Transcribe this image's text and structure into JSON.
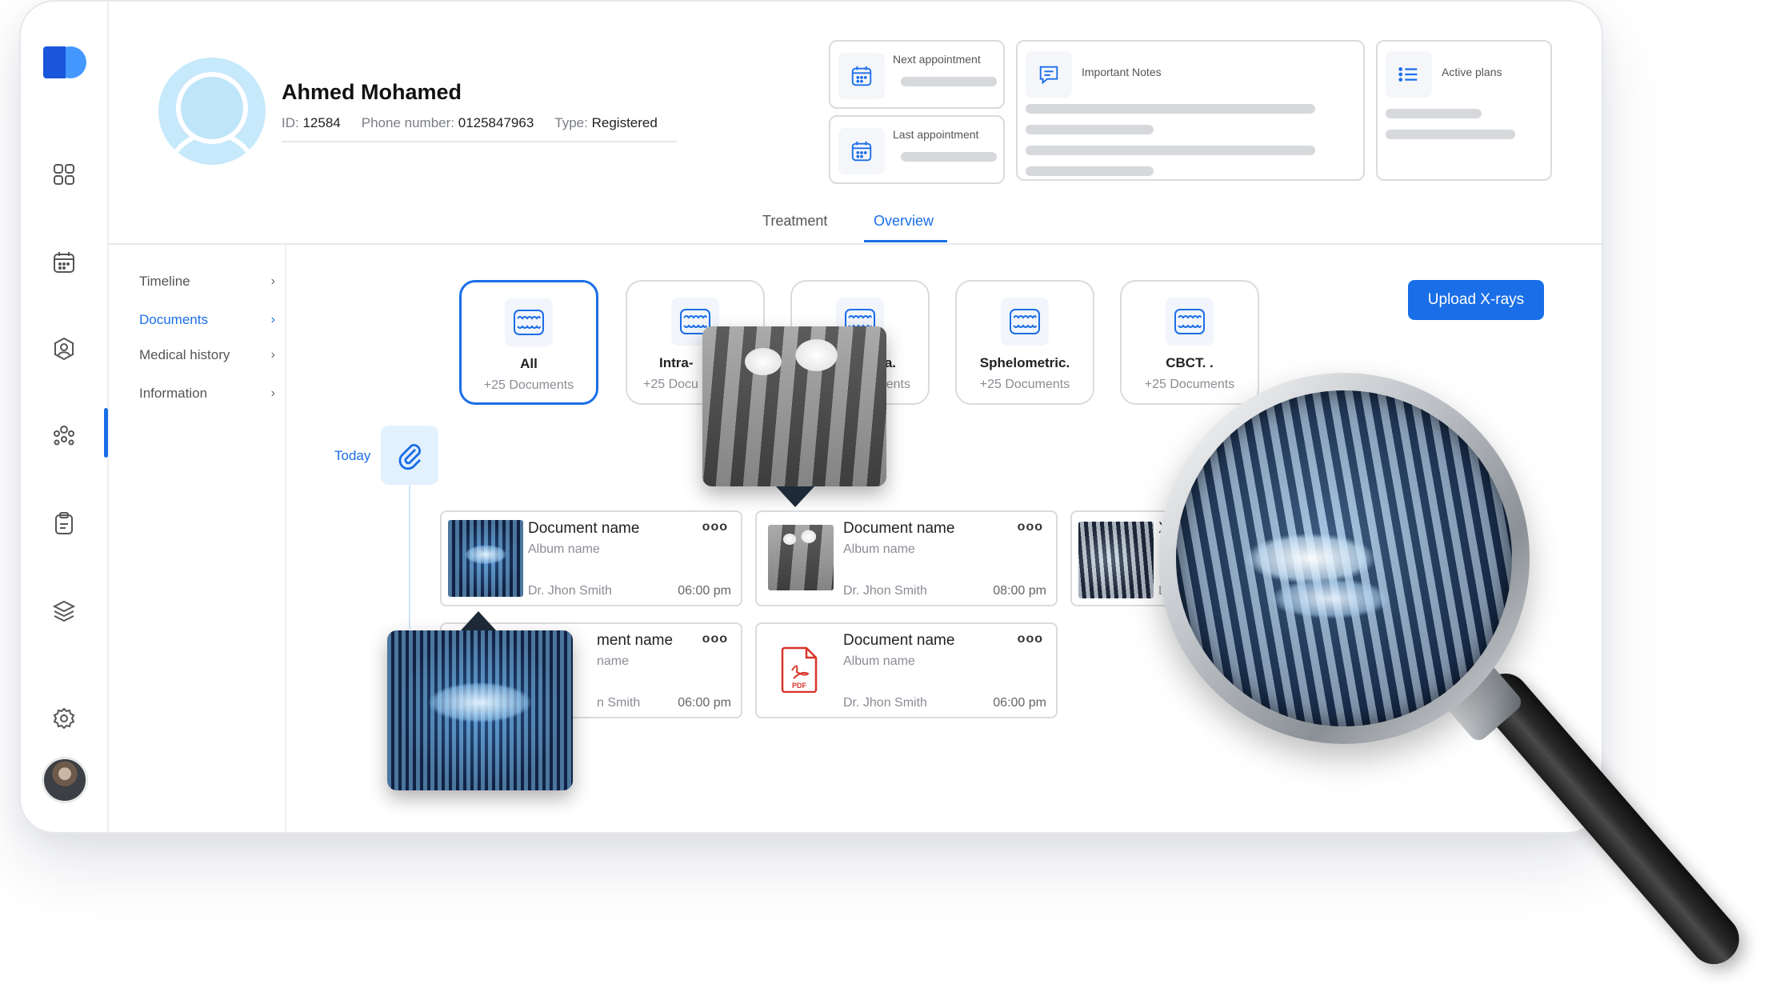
{
  "patient": {
    "name": "Ahmed Mohamed",
    "id_label": "ID:",
    "id_value": "12584",
    "phone_label": "Phone number:",
    "phone_value": "0125847963",
    "type_label": "Type:",
    "type_value": "Registered"
  },
  "cards": {
    "next_appointment": "Next appointment",
    "last_appointment": "Last appointment",
    "important_notes": "Important Notes",
    "active_plans": "Active plans"
  },
  "tabs": [
    {
      "label": "Treatment",
      "active": false
    },
    {
      "label": "Overview",
      "active": true
    }
  ],
  "menu": [
    {
      "label": "Timeline",
      "active": false
    },
    {
      "label": "Documents",
      "active": true
    },
    {
      "label": "Medical history",
      "active": false
    },
    {
      "label": "Information",
      "active": false
    }
  ],
  "categories": [
    {
      "name": "All",
      "count": "+25 Documents",
      "active": true
    },
    {
      "name": "Intra-",
      "count": "+25 Docu",
      "active": false
    },
    {
      "name": "a.",
      "count": "ents",
      "active": false
    },
    {
      "name": "Sphelometric.",
      "count": "+25 Documents",
      "active": false
    },
    {
      "name": "CBCT. .",
      "count": "+25 Documents",
      "active": false
    }
  ],
  "upload_button": "Upload X-rays",
  "timeline": {
    "today": "Today"
  },
  "documents": [
    {
      "name": "Document name",
      "album": "Album name",
      "doctor": "Dr. Jhon Smith",
      "time": "06:00 pm"
    },
    {
      "name": "Document name",
      "album": "Album name",
      "doctor": "Dr. Jhon Smith",
      "time": "08:00 pm"
    },
    {
      "name": "X",
      "album": "",
      "doctor": "D",
      "time": ""
    },
    {
      "name": "ment name",
      "album": "name",
      "doctor": "n Smith",
      "time": "06:00 pm"
    },
    {
      "name": "Document name",
      "album": "Album name",
      "doctor": "Dr. Jhon Smith",
      "time": "06:00 pm"
    }
  ],
  "more_glyph": "ooo",
  "pdf_label": "PDF",
  "colors": {
    "accent": "#1a6ee8",
    "brand_dark": "#1a56db",
    "skeleton": "#d6d8dc"
  }
}
